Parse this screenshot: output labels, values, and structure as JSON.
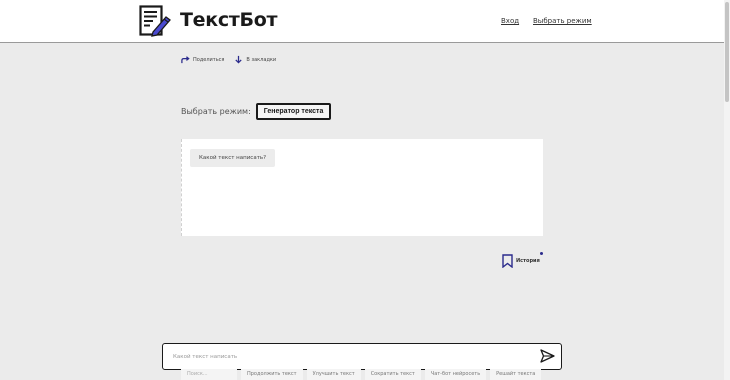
{
  "header": {
    "logo_text": "ТекстБот",
    "nav": {
      "login": "Вход",
      "select_mode": "Выбрать режим"
    }
  },
  "actions": {
    "share": "Поделиться",
    "bookmarks": "В закладки"
  },
  "mode": {
    "label": "Выбрать режим:",
    "current": "Генератор текста"
  },
  "chat": {
    "prompt_bubble": "Какой текст написать?"
  },
  "history": {
    "label": "История"
  },
  "input": {
    "placeholder": "Какой текст написать"
  },
  "suggestions": [
    "Поиск...",
    "Продолжить текст",
    "Улучшить текст",
    "Сократить текст",
    "Чат-бот нейросеть",
    "Решайт текста"
  ],
  "colors": {
    "accent": "#2b2b8c",
    "border_dark": "#1a1a1a",
    "background": "#ebebeb"
  }
}
